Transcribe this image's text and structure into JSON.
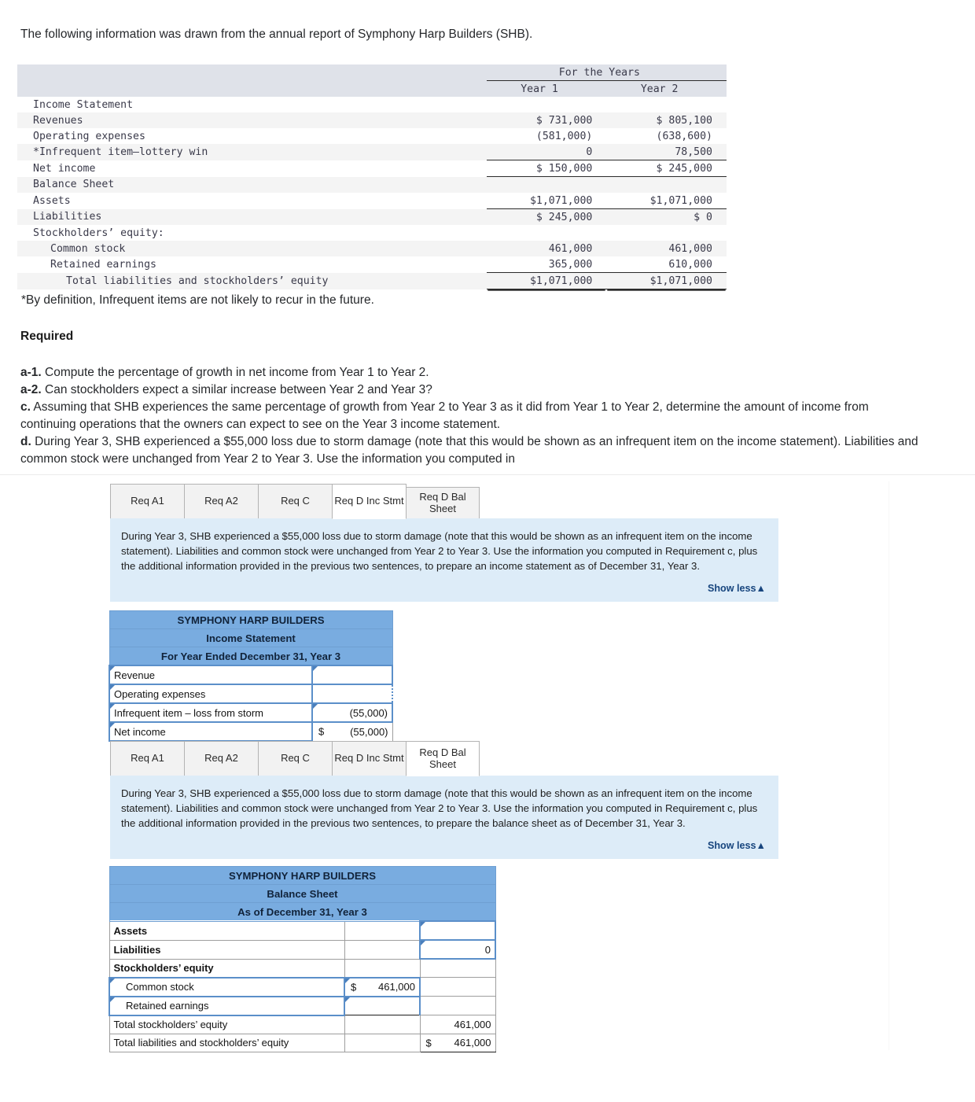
{
  "intro": "The following information was drawn from the annual report of Symphony Harp Builders (SHB).",
  "fin_table": {
    "span_header": "For the Years",
    "col1": "Year 1",
    "col2": "Year 2",
    "rows": [
      {
        "label": "Income Statement",
        "y1": "",
        "y2": ""
      },
      {
        "label": "Revenues",
        "y1": "$ 731,000",
        "y2": "$ 805,100"
      },
      {
        "label": "Operating expenses",
        "y1": "(581,000)",
        "y2": "(638,600)"
      },
      {
        "label": "*Infrequent item–lottery win",
        "y1": "0",
        "y2": "78,500"
      },
      {
        "label": "Net income",
        "y1": "$ 150,000",
        "y2": "$ 245,000"
      },
      {
        "label": "Balance Sheet",
        "y1": "",
        "y2": ""
      },
      {
        "label": "Assets",
        "y1": "$1,071,000",
        "y2": "$1,071,000"
      },
      {
        "label": "Liabilities",
        "y1": "$ 245,000",
        "y2": "$ 0"
      },
      {
        "label": "Stockholders’ equity:",
        "y1": "",
        "y2": ""
      },
      {
        "label": "Common stock",
        "y1": "461,000",
        "y2": "461,000"
      },
      {
        "label": "Retained earnings",
        "y1": "365,000",
        "y2": "610,000"
      },
      {
        "label": "Total liabilities and stockholders’ equity",
        "y1": "$1,071,000",
        "y2": "$1,071,000"
      }
    ]
  },
  "footnote": "*By definition, Infrequent items are not likely to recur in the future.",
  "required_heading": "Required",
  "requirements": [
    {
      "tag": "a-1.",
      "text": " Compute the percentage of growth in net income from Year 1 to Year 2."
    },
    {
      "tag": "a-2.",
      "text": " Can stockholders expect a similar increase between Year 2 and Year 3?"
    },
    {
      "tag": "c.",
      "text": " Assuming that SHB experiences the same percentage of growth from Year 2 to Year 3 as it did from Year 1 to Year 2, determine the amount of income from continuing operations that the owners can expect to see on the Year 3 income statement."
    },
    {
      "tag": "d.",
      "text": " During Year 3, SHB experienced a $55,000 loss due to storm damage (note that this would be shown as an infrequent item on the income statement). Liabilities and common stock were unchanged from Year 2 to Year 3. Use the information you computed in"
    }
  ],
  "tabs": [
    "Req A1",
    "Req A2",
    "Req C",
    "Req D Inc Stmt",
    "Req D Bal Sheet"
  ],
  "panel_inc": {
    "active_tab": "Req D Inc Stmt",
    "text": "During Year 3, SHB experienced a $55,000 loss due to storm damage (note that this would be shown as an infrequent item on the income statement). Liabilities and common stock were unchanged from Year 2 to Year 3. Use the information you computed in Requirement c, plus the additional information provided in the previous two sentences, to prepare an income statement as of December 31, Year 3.",
    "show_less": "Show less▲"
  },
  "panel_bal": {
    "active_tab": "Req D Bal Sheet",
    "text": "During Year 3, SHB experienced a $55,000 loss due to storm damage (note that this would be shown as an infrequent item on the income statement). Liabilities and common stock were unchanged from Year 2 to Year 3. Use the information you computed in Requirement c, plus the additional information provided in the previous two sentences, to prepare the balance sheet as of December 31, Year 3.",
    "show_less": "Show less▲"
  },
  "income_statement": {
    "title1": "SYMPHONY HARP BUILDERS",
    "title2": "Income Statement",
    "title3": "For Year Ended December 31, Year 3",
    "rows": [
      {
        "label": "Revenue",
        "dollar": "",
        "value": ""
      },
      {
        "label": "Operating expenses",
        "dollar": "",
        "value": ""
      },
      {
        "label": "Infrequent item – loss from storm",
        "dollar": "",
        "value": "(55,000)"
      },
      {
        "label": "Net income",
        "dollar": "$",
        "value": "(55,000)"
      }
    ]
  },
  "balance_sheet": {
    "title1": "SYMPHONY HARP BUILDERS",
    "title2": "Balance Sheet",
    "title3": "As of December 31, Year 3",
    "rows": [
      {
        "label": "Assets",
        "mid": "",
        "mid_dollar": "",
        "right": "",
        "right_dollar": ""
      },
      {
        "label": "Liabilities",
        "mid": "",
        "mid_dollar": "",
        "right": "0",
        "right_dollar": ""
      },
      {
        "label": "Stockholders’ equity",
        "mid": "",
        "mid_dollar": "",
        "right": "",
        "right_dollar": ""
      },
      {
        "label": "Common stock",
        "mid": "461,000",
        "mid_dollar": "$",
        "right": "",
        "right_dollar": ""
      },
      {
        "label": "Retained earnings",
        "mid": "",
        "mid_dollar": "",
        "right": "",
        "right_dollar": ""
      },
      {
        "label": "Total stockholders’ equity",
        "mid": "",
        "mid_dollar": "",
        "right": "461,000",
        "right_dollar": ""
      },
      {
        "label": "Total liabilities and stockholders’ equity",
        "mid": "",
        "mid_dollar": "",
        "right": "461,000",
        "right_dollar": "$"
      }
    ]
  },
  "colors": {
    "header_blue": "#79ace0",
    "panel_blue": "#ddecf8",
    "link_blue": "#17457e",
    "cell_border_blue": "#5b8fc9"
  }
}
